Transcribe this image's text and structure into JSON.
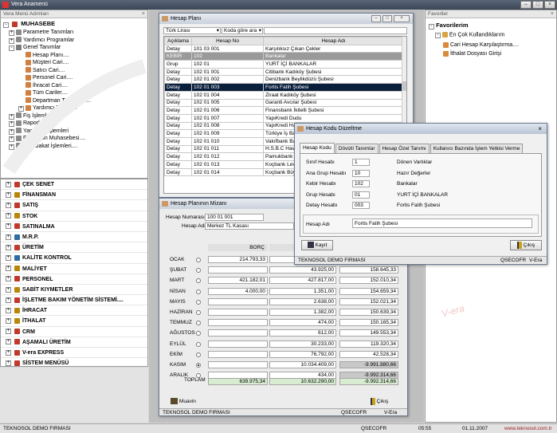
{
  "app_title": "Vera Anamenü",
  "left_panel": {
    "title": "Vera Menü Adımları",
    "root": "MUHASEBE",
    "tree": [
      {
        "label": "Parametre Tanımları",
        "level": 1,
        "exp": "+"
      },
      {
        "label": "Yardımcı Programlar",
        "level": 1,
        "exp": "+"
      },
      {
        "label": "Genel Tanımlar",
        "level": 1,
        "exp": "-"
      },
      {
        "label": "Hesap Planı....",
        "level": 2,
        "exp": ""
      },
      {
        "label": "Müşteri Cari....",
        "level": 2,
        "exp": ""
      },
      {
        "label": "Satıcı Cari....",
        "level": 2,
        "exp": ""
      },
      {
        "label": "Personel Cari....",
        "level": 2,
        "exp": ""
      },
      {
        "label": "İhracat Cari....",
        "level": 2,
        "exp": ""
      },
      {
        "label": "Tüm Cariler....",
        "level": 2,
        "exp": ""
      },
      {
        "label": "Departman Tanımları....",
        "level": 2,
        "exp": ""
      },
      {
        "label": "Yardımcı Tanımlar",
        "level": 2,
        "exp": "+"
      },
      {
        "label": "Fiş İşlemleri",
        "level": 1,
        "exp": "+"
      },
      {
        "label": "Raporlar",
        "level": 1,
        "exp": "+"
      },
      {
        "label": "Yansıtma İşlemleri",
        "level": 1,
        "exp": "+"
      },
      {
        "label": "Enflasyon Muhasebesi....",
        "level": 1,
        "exp": "+"
      },
      {
        "label": "Mutabakat İşlemleri....",
        "level": 1,
        "exp": "+"
      }
    ],
    "modules": [
      {
        "label": "ÇEK SENET",
        "color": "#c0392b"
      },
      {
        "label": "FİNANSMAN",
        "color": "#b8860b"
      },
      {
        "label": "SATIŞ",
        "color": "#c0392b"
      },
      {
        "label": "STOK",
        "color": "#b8860b"
      },
      {
        "label": "SATINALMA",
        "color": "#c0392b"
      },
      {
        "label": "M.R.P.",
        "color": "#2e6da4"
      },
      {
        "label": "ÜRETİM",
        "color": "#c0392b"
      },
      {
        "label": "KALİTE KONTROL",
        "color": "#2e6da4"
      },
      {
        "label": "MALİYET",
        "color": "#b8860b"
      },
      {
        "label": "PERSONEL",
        "color": "#c0392b"
      },
      {
        "label": "SABİT KIYMETLER",
        "color": "#b8860b"
      },
      {
        "label": "İŞLETME BAKIM YÖNETİM SİSTEMİ....",
        "color": "#c0392b"
      },
      {
        "label": "İHRACAT",
        "color": "#b8860b"
      },
      {
        "label": "İTHALAT",
        "color": "#b8860b"
      },
      {
        "label": "CRM",
        "color": "#c0392b"
      },
      {
        "label": "AŞAMALI ÜRETİM",
        "color": "#c0392b"
      },
      {
        "label": "V-era EXPRESS",
        "color": "#c0392b"
      },
      {
        "label": "SİSTEM MENÜSÜ",
        "color": "#c0392b"
      }
    ]
  },
  "favorites": {
    "title": "Favoriler",
    "header": "Favorilerim",
    "group": "En Çok Kullandıklarım",
    "items": [
      "Cari Hesap Karşılaştırma....",
      "İthalat Dosyası Girişi"
    ]
  },
  "hesap_plani": {
    "title": "Hesap Planı",
    "currency": "Türk Lirası",
    "sort": "Koda göre ara",
    "columns": [
      "Açıklama",
      "Hesap No",
      "Hesap Adı"
    ],
    "rows": [
      [
        "Detay",
        "101 03 001",
        "Karşılıksız Çıkan Çekler"
      ],
      [
        "KEBİR",
        "102",
        "Bankalar"
      ],
      [
        "Grup",
        "102 01",
        "YURT İÇİ BANKALAR"
      ],
      [
        "Detay",
        "102 01 001",
        "Citibank Kadıköy Şubesi"
      ],
      [
        "Detay",
        "102 01 002",
        "Denizbank Beylikdüzü Şubesi"
      ],
      [
        "Detay",
        "102 01 003",
        "Fortis Fatih Şubesi"
      ],
      [
        "Detay",
        "102 01 004",
        "Ziraat Kadıköy Şubesi"
      ],
      [
        "Detay",
        "102 01 005",
        "Garanti Avcılar Şubesi"
      ],
      [
        "Detay",
        "102 01 006",
        "Finansbank İkitelli Şubesi"
      ],
      [
        "Detay",
        "102 01 007",
        "YapıKredi Dudu"
      ],
      [
        "Detay",
        "102 01 008",
        "YapıKredi Has"
      ],
      [
        "Detay",
        "102 01 009",
        "Türkiye İş Ban"
      ],
      [
        "Detay",
        "102 01 010",
        "Vakıfbank Bak"
      ],
      [
        "Detay",
        "102 01 011",
        "H.S.B.C Havar"
      ],
      [
        "Detay",
        "102 01 012",
        "Pamukbank T"
      ],
      [
        "Detay",
        "102 01 013",
        "Koçbank Leve"
      ],
      [
        "Detay",
        "102 01 014",
        "Koçbank Büyü"
      ]
    ]
  },
  "mizan": {
    "title": "Hesap Planının Mizanı",
    "hesap_numarasi_label": "Hesap Numarası",
    "hesap_numarasi": "100 01 001",
    "hesap_adi_label": "Hesap Adı",
    "hesap_adi": "Merkez TL Kasası",
    "borc_label": "BORÇ",
    "months": [
      {
        "m": "OCAK",
        "borc": "214.793,33",
        "alacak": "",
        "bakiye": "",
        "sel": false
      },
      {
        "m": "ŞUBAT",
        "borc": "",
        "alacak": "43.925,00",
        "bakiye": "158.645,33",
        "sel": false
      },
      {
        "m": "MART",
        "borc": "421.182,01",
        "alacak": "427.817,00",
        "bakiye": "152.010,34",
        "sel": false
      },
      {
        "m": "NİSAN",
        "borc": "4.000,00",
        "alacak": "1.351,00",
        "bakiye": "154.659,34",
        "sel": false
      },
      {
        "m": "MAYIS",
        "borc": "",
        "alacak": "2.638,00",
        "bakiye": "152.021,34",
        "sel": false
      },
      {
        "m": "HAZİRAN",
        "borc": "",
        "alacak": "1.382,00",
        "bakiye": "150.639,34",
        "sel": false
      },
      {
        "m": "TEMMUZ",
        "borc": "",
        "alacak": "474,00",
        "bakiye": "150.165,34",
        "sel": false
      },
      {
        "m": "AĞUSTOS",
        "borc": "",
        "alacak": "612,00",
        "bakiye": "149.553,34",
        "sel": false
      },
      {
        "m": "EYLÜL",
        "borc": "",
        "alacak": "30.233,00",
        "bakiye": "119.320,34",
        "sel": false
      },
      {
        "m": "EKİM",
        "borc": "",
        "alacak": "76.792,00",
        "bakiye": "42.528,34",
        "sel": false
      },
      {
        "m": "KASIM",
        "borc": "",
        "alacak": "10.034.409,00",
        "bakiye": "-9.991.880,66",
        "sel": true
      },
      {
        "m": "ARALIK",
        "borc": "",
        "alacak": "434,00",
        "bakiye": "-9.992.314,66",
        "sel": false
      }
    ],
    "toplam_label": "TOPLAM",
    "toplam": [
      "639.975,34",
      "10.632.290,00",
      "-9.992.314,66"
    ],
    "muavin_label": "Muavin",
    "cikis_label": "Çıkış",
    "status": [
      "TEKNOSOL DEMO FIRMASI",
      "QSECOFR",
      "V-Era"
    ]
  },
  "duzenleme": {
    "title": "Hesap Kodu Düzeltme",
    "tabs": [
      "Hesap Kodu",
      "Dövizli Tanımlar",
      "Hesap Özel Tanımı",
      "Kullanıcı Bazında İşlem Yetkisi Verme"
    ],
    "fields": [
      {
        "label": "Sınıf Hesabı",
        "code": "1",
        "name": "Dönen Varlıklar"
      },
      {
        "label": "Ana Grup Hesabı",
        "code": "10",
        "name": "Hazır Değerler"
      },
      {
        "label": "Kebir Hesabı",
        "code": "102",
        "name": "Bankalar"
      },
      {
        "label": "Grup Hesabı",
        "code": "01",
        "name": "YURT İÇİ BANKALAR"
      },
      {
        "label": "Detay Hesabı",
        "code": "003",
        "name": "Fortis Fatih Şubesi"
      }
    ],
    "hesap_adi_label": "Hesap Adı",
    "hesap_adi": "Fortis Fatih Şubesi",
    "kayit_label": "Kayıt",
    "cikis_label": "Çıkış",
    "status": [
      "TEKNOSOL DEMO FIRMASI",
      "QSECOFR",
      "V-Era"
    ]
  },
  "statusbar": {
    "company": "TEKNOSOL DEMO FIRMASI",
    "user": "QSECOFR",
    "time": "05:55",
    "date": "01.11.2007",
    "url": "www.teknosol.com.tr"
  }
}
